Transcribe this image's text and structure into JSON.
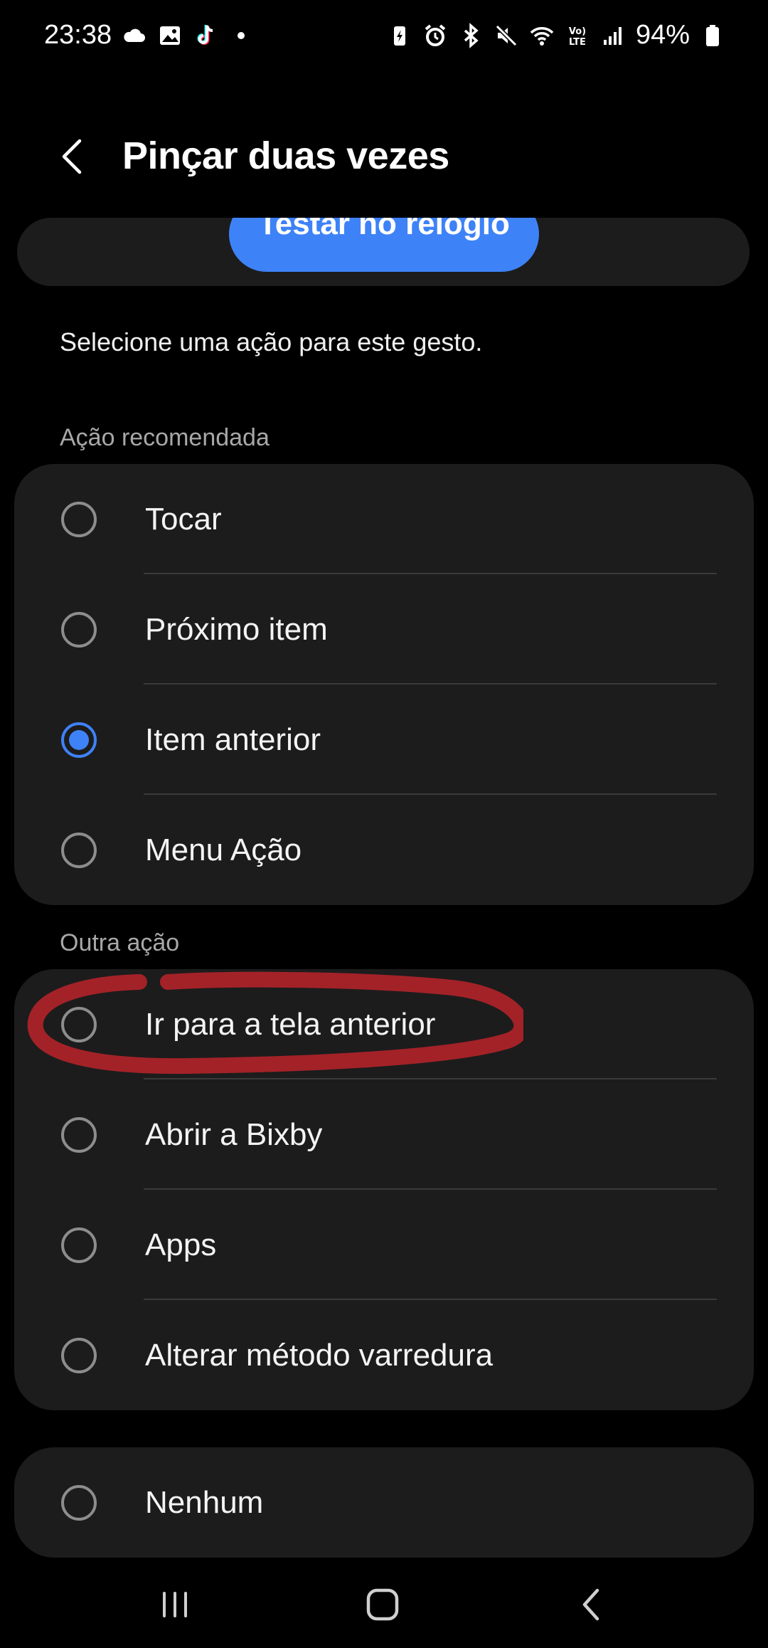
{
  "status_bar": {
    "time": "23:38",
    "battery": "94%",
    "left_icons": [
      "cloud-icon",
      "gallery-icon",
      "tiktok-icon",
      "dot-icon"
    ],
    "right_icons": [
      "battery-saver-icon",
      "alarm-icon",
      "bluetooth-icon",
      "mute-icon",
      "wifi-icon",
      "volte-icon",
      "signal-icon",
      "battery-icon"
    ]
  },
  "header": {
    "title": "Pinçar duas vezes"
  },
  "top_card": {
    "button_label": "Testar no relógio"
  },
  "description": "Selecione uma ação para este gesto.",
  "sections": {
    "recommended": {
      "header": "Ação recomendada",
      "options": [
        {
          "label": "Tocar",
          "selected": false
        },
        {
          "label": "Próximo item",
          "selected": false
        },
        {
          "label": "Item anterior",
          "selected": true
        },
        {
          "label": "Menu Ação",
          "selected": false
        }
      ]
    },
    "other": {
      "header": "Outra ação",
      "options": [
        {
          "label": "Ir para a tela anterior",
          "selected": false
        },
        {
          "label": "Abrir a Bixby",
          "selected": false
        },
        {
          "label": "Apps",
          "selected": false
        },
        {
          "label": "Alterar método varredura",
          "selected": false
        }
      ]
    },
    "none": {
      "options": [
        {
          "label": "Nenhum",
          "selected": false
        }
      ]
    }
  },
  "colors": {
    "accent": "#3e82f7",
    "card": "#1c1c1c",
    "annotation": "#a32228"
  },
  "nav_bar": {
    "icons": [
      "recents-icon",
      "home-icon",
      "back-icon"
    ]
  }
}
